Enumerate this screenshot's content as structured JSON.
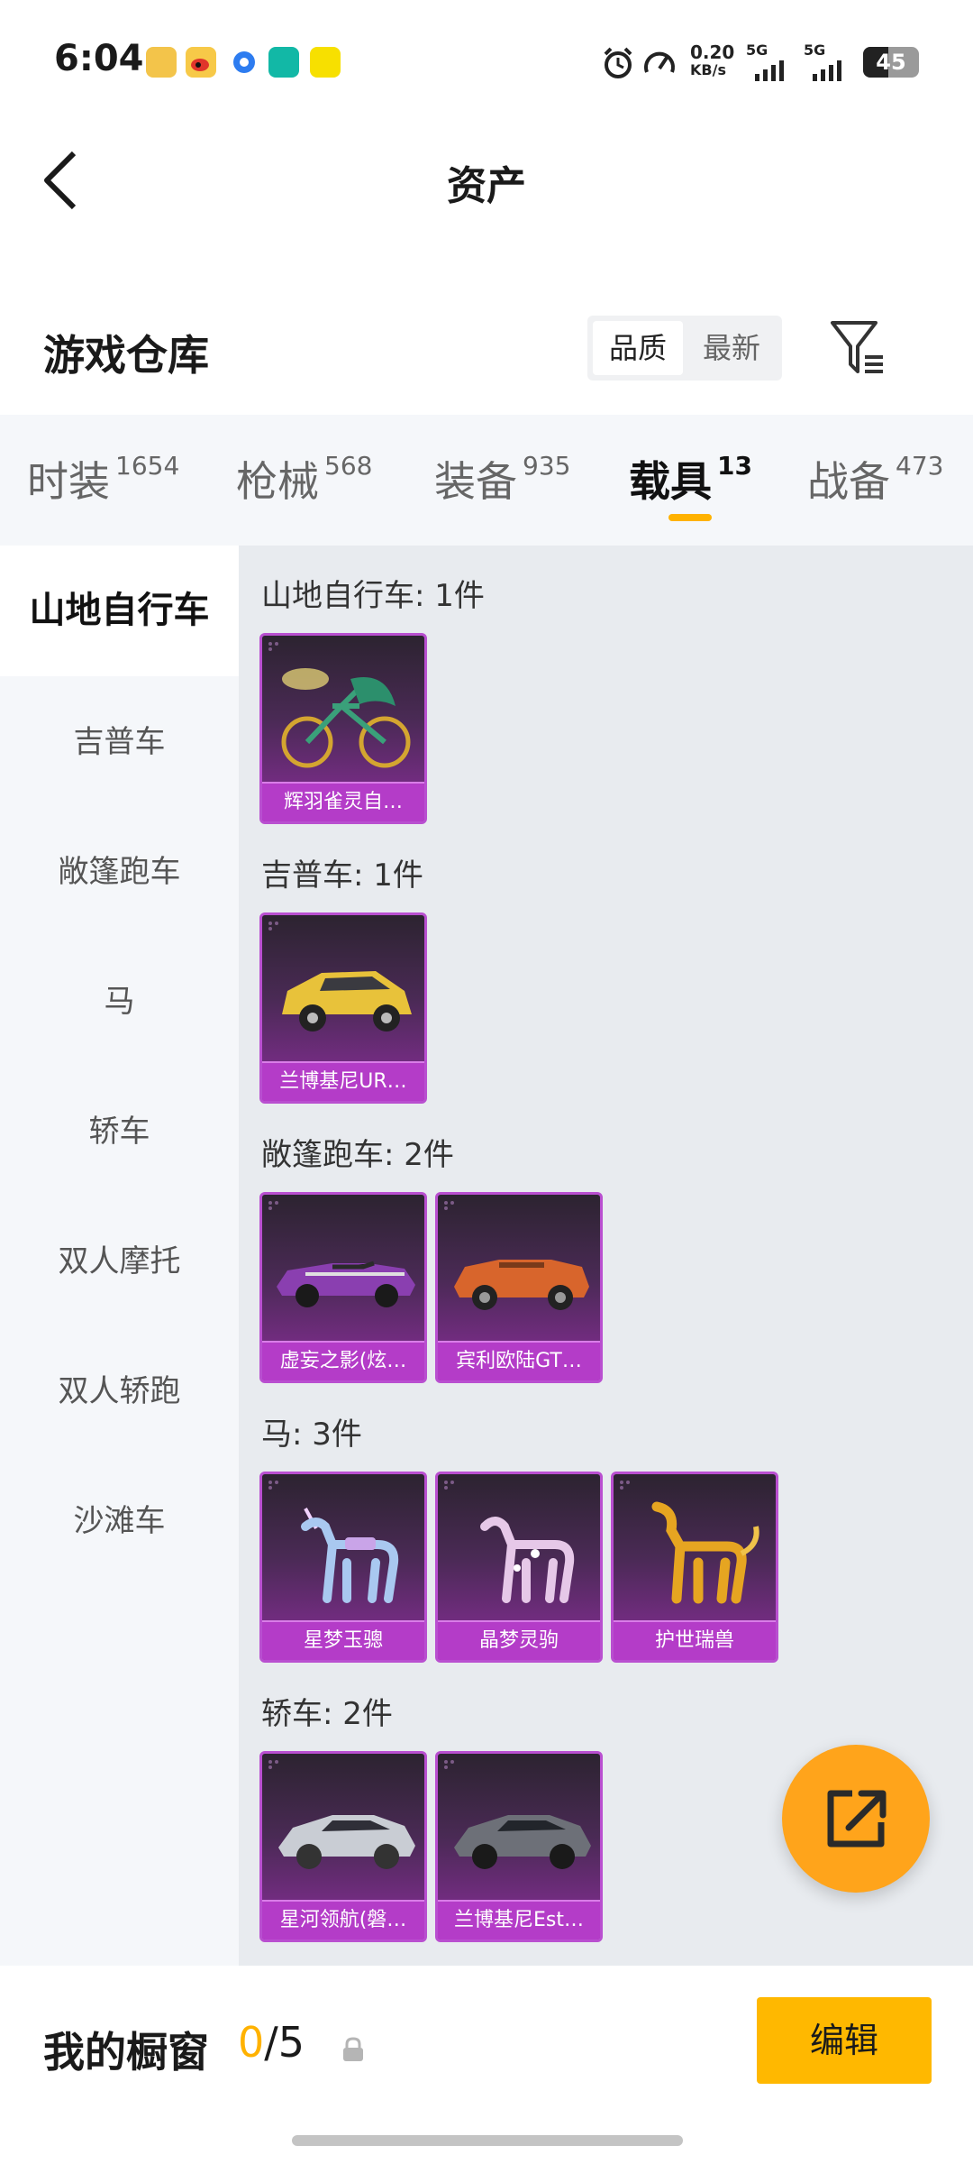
{
  "status_bar": {
    "time": "6:04",
    "net_speed": "0.20",
    "net_unit": "KB/s",
    "sim1": "5G",
    "sim2": "5G",
    "battery": "45"
  },
  "header": {
    "title": "资产"
  },
  "warehouse": {
    "title": "游戏仓库",
    "sort_options": [
      "品质",
      "最新"
    ],
    "selected_sort": "品质"
  },
  "tabs": [
    {
      "label": "时装",
      "count": "1654",
      "active": false
    },
    {
      "label": "枪械",
      "count": "568",
      "active": false
    },
    {
      "label": "装备",
      "count": "935",
      "active": false
    },
    {
      "label": "载具",
      "count": "13",
      "active": true
    },
    {
      "label": "战备",
      "count": "473",
      "active": false
    }
  ],
  "side_nav": [
    {
      "label": "山地自行车",
      "active": true
    },
    {
      "label": "吉普车",
      "active": false
    },
    {
      "label": "敞篷跑车",
      "active": false
    },
    {
      "label": "马",
      "active": false
    },
    {
      "label": "轿车",
      "active": false
    },
    {
      "label": "双人摩托",
      "active": false
    },
    {
      "label": "双人轿跑",
      "active": false
    },
    {
      "label": "沙滩车",
      "active": false
    }
  ],
  "sections": [
    {
      "title": "山地自行车: 1件",
      "items": [
        {
          "name": "辉羽雀灵自…",
          "icon": "bike-icon",
          "color": "#d4a530"
        }
      ]
    },
    {
      "title": "吉普车: 1件",
      "items": [
        {
          "name": "兰博基尼UR…",
          "icon": "suv-icon",
          "color": "#e8c23a"
        }
      ]
    },
    {
      "title": "敞篷跑车: 2件",
      "items": [
        {
          "name": "虚妄之影(炫…",
          "icon": "muscle-car-icon",
          "color": "#8a3fb0"
        },
        {
          "name": "宾利欧陆GT…",
          "icon": "convertible-icon",
          "color": "#d8652c"
        }
      ]
    },
    {
      "title": "马: 3件",
      "items": [
        {
          "name": "星梦玉骢",
          "icon": "horse-icon",
          "color": "#a9c8f0"
        },
        {
          "name": "晶梦灵驹",
          "icon": "horse-icon",
          "color": "#e6c8e8"
        },
        {
          "name": "护世瑞兽",
          "icon": "beast-icon",
          "color": "#e6a521"
        }
      ]
    },
    {
      "title": "轿车: 2件",
      "items": [
        {
          "name": "星河领航(磐…",
          "icon": "sedan-icon",
          "color": "#c9cdd4"
        },
        {
          "name": "兰博基尼Est…",
          "icon": "sedan-icon",
          "color": "#6d7078"
        }
      ]
    }
  ],
  "showcase": {
    "label": "我的橱窗",
    "used": "0",
    "separator": "/",
    "total": "5",
    "edit_label": "编辑"
  },
  "colors": {
    "accent": "#ffb800",
    "card_border": "#b94fd0",
    "card_label_bg": "#b43cc8",
    "fab": "#ffa41b"
  }
}
